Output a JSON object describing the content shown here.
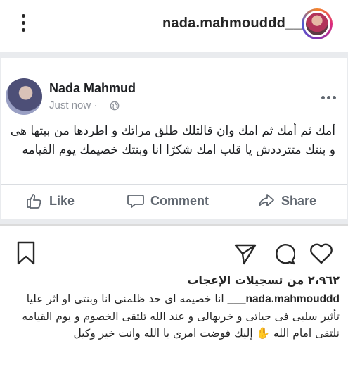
{
  "instagram": {
    "username": "nada.mahmouddd___",
    "likes_text": "٢،٩٦٢ من تسجيلات الإعجاب",
    "caption_user": "nada.mahmouddd___",
    "caption_text": " انا خصيمه اى حد ظلمنى انا وبنتى او اثر عليا تأثير سلبى فى حياتى و خربهالى و عند الله تلتقى الخصوم و يوم القيامه نلتقى امام الله ✋ إليك فوضت امرى يا الله وانت خير وكيل"
  },
  "facebook_post": {
    "author": "Nada Mahmud",
    "time": "Just now · ",
    "text": "أمك ثم أمك ثم امك وان قالتلك طلق مراتك و  اطردها من بيتها هى و بنتك متترددش يا قلب امك  شكرًا انا وبنتك خصيمك يوم القيامه",
    "actions": {
      "like": "Like",
      "comment": "Comment",
      "share": "Share"
    }
  },
  "icons": {
    "options": "vertical-dots-icon",
    "more": "horizontal-dots-icon",
    "globe": "globe-icon",
    "bookmark": "bookmark-icon",
    "send": "send-icon",
    "comment": "comment-bubble-icon",
    "heart": "heart-icon"
  }
}
